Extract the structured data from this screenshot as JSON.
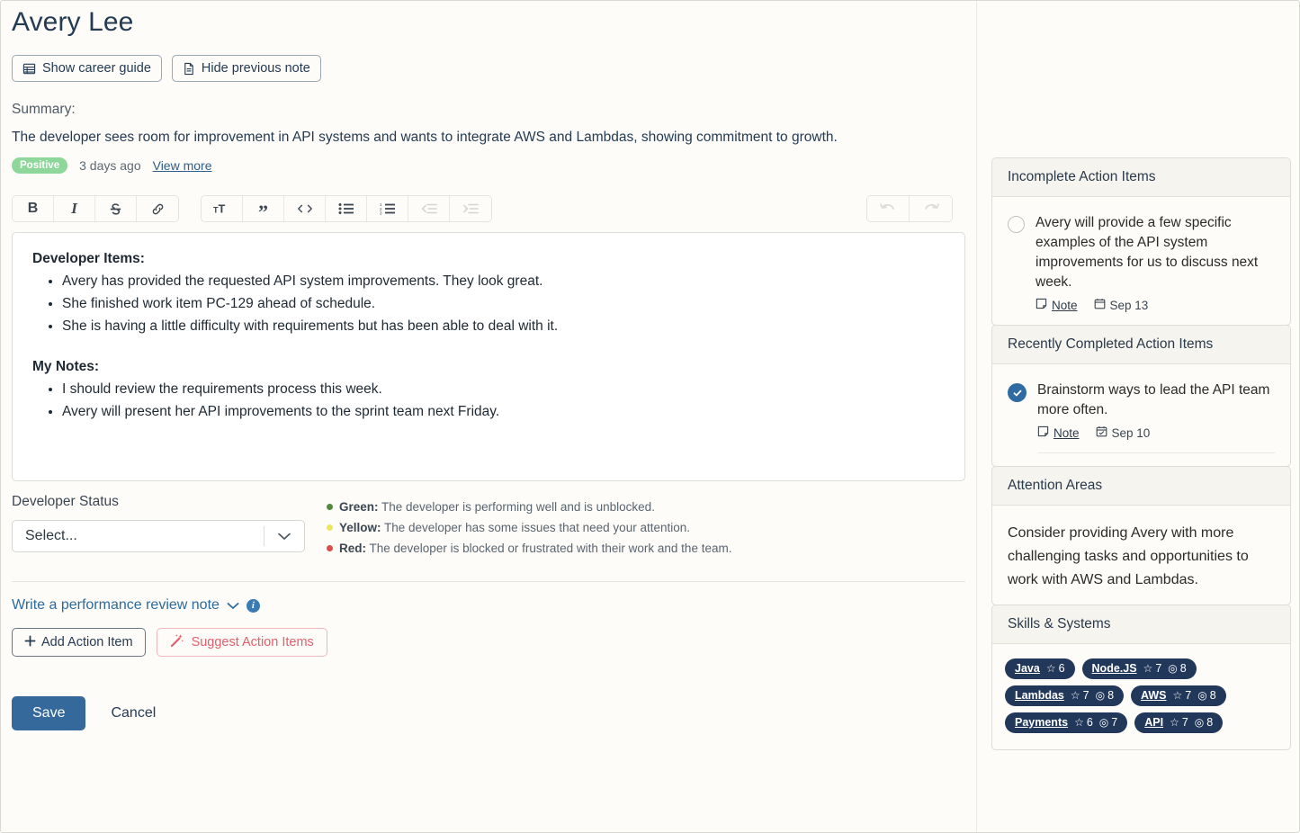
{
  "header": {
    "title": "Avery Lee",
    "buttons": [
      {
        "label": "Show career guide",
        "icon": "table-icon"
      },
      {
        "label": "Hide previous note",
        "icon": "document-icon"
      }
    ]
  },
  "summary": {
    "label": "Summary:",
    "text": "The developer sees room for improvement in API systems and wants to integrate AWS and Lambdas, showing commitment to growth.",
    "sentiment": "Positive",
    "sentiment_color": "#8ed79a",
    "timestamp": "3 days ago",
    "view_more": "View more"
  },
  "toolbar": {
    "group1": [
      {
        "name": "bold-icon",
        "glyph": "B"
      },
      {
        "name": "italic-icon",
        "glyph": "I"
      },
      {
        "name": "strikethrough-icon",
        "glyph": "S"
      },
      {
        "name": "link-icon",
        "glyph": "link"
      }
    ],
    "group2": [
      {
        "name": "text-size-icon",
        "glyph": "TT"
      },
      {
        "name": "blockquote-icon",
        "glyph": "”"
      },
      {
        "name": "code-icon",
        "glyph": "<>"
      },
      {
        "name": "bullet-list-icon",
        "glyph": "ul"
      },
      {
        "name": "numbered-list-icon",
        "glyph": "ol"
      },
      {
        "name": "outdent-icon",
        "glyph": "outdent"
      },
      {
        "name": "indent-icon",
        "glyph": "indent"
      }
    ],
    "history": [
      {
        "name": "undo-icon",
        "glyph": "undo"
      },
      {
        "name": "redo-icon",
        "glyph": "redo"
      }
    ]
  },
  "editor": {
    "section1_heading": "Developer Items:",
    "section1_items": [
      "Avery has provided the requested API system improvements. They look great.",
      "She finished work item PC-129 ahead of schedule.",
      "She is having a little difficulty with requirements but has been able to deal with it."
    ],
    "section2_heading": "My Notes:",
    "section2_items": [
      "I should review the requirements process this week.",
      "Avery will present her API improvements to the sprint team next Friday."
    ]
  },
  "status": {
    "label": "Developer Status",
    "select_value": "Select...",
    "legend": [
      {
        "color": "#4f8a3d",
        "name": "Green:",
        "desc": "The developer is performing well and is unblocked."
      },
      {
        "color": "#e8e05a",
        "name": "Yellow:",
        "desc": "The developer has some issues that need your attention."
      },
      {
        "color": "#dd4b4b",
        "name": "Red:",
        "desc": "The developer is blocked or frustrated with their work and the team."
      }
    ]
  },
  "review_note": {
    "link": "Write a performance review note",
    "chevron": "⌄",
    "info": "i"
  },
  "action_buttons": {
    "add_label": "Add Action Item",
    "add_icon": "plus-icon",
    "suggest_label": "Suggest Action Items",
    "suggest_icon": "magic-wand-icon",
    "suggest_color": "#e2606d"
  },
  "footer": {
    "save_label": "Save",
    "save_color": "#35699c",
    "cancel_label": "Cancel"
  },
  "sidebar": {
    "incomplete": {
      "title": "Incomplete Action Items",
      "items": [
        {
          "text": "Avery will provide a few specific examples of the API system improvements for us to discuss next week.",
          "note_label": "Note",
          "date": "Sep 13",
          "completed": false
        }
      ]
    },
    "completed": {
      "title": "Recently Completed Action Items",
      "items": [
        {
          "text": "Brainstorm ways to lead the API team more often.",
          "note_label": "Note",
          "date": "Sep 10",
          "completed": true
        }
      ]
    },
    "attention": {
      "title": "Attention Areas",
      "text": "Consider providing Avery with more challenging tasks and opportunities to work with AWS and Lambdas."
    },
    "skills": {
      "title": "Skills & Systems",
      "badge_color": "#22385a",
      "items": [
        {
          "name": "Java",
          "star": "6",
          "target": null
        },
        {
          "name": "Node.JS",
          "star": "7",
          "target": "8"
        },
        {
          "name": "Lambdas",
          "star": "7",
          "target": "8"
        },
        {
          "name": "AWS",
          "star": "7",
          "target": "8"
        },
        {
          "name": "Payments",
          "star": "6",
          "target": "7"
        },
        {
          "name": "API",
          "star": "7",
          "target": "8"
        }
      ]
    }
  }
}
